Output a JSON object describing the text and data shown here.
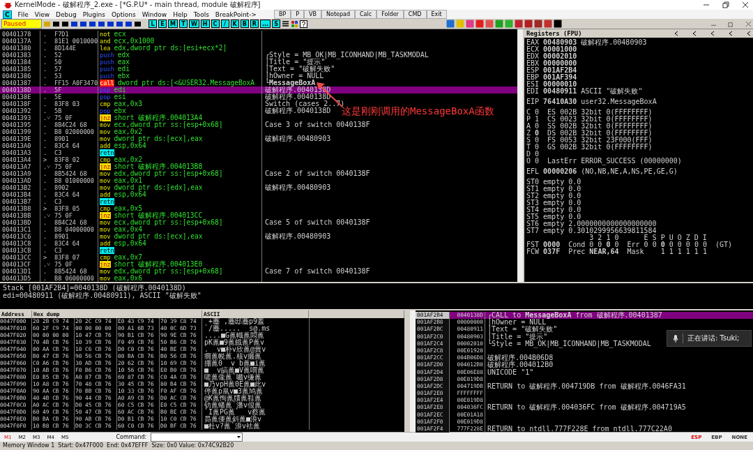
{
  "window": {
    "title": "KernelMode - 破解程序_2.exe - [*G.P.U* - main thread, module 破解程序]"
  },
  "menu": {
    "app_button": "C",
    "items": [
      "File",
      "View",
      "Debug",
      "Plugins",
      "Options",
      "Window",
      "Help",
      "Tools",
      "BreakPoint->"
    ],
    "tool_buttons": [
      "BP",
      "P",
      "VB",
      "Notepad",
      "Calc",
      "Folder",
      "CMD",
      "Exit"
    ]
  },
  "toolbar": {
    "status": "Paused",
    "letter_buttons": [
      "L",
      "E",
      "M",
      "T",
      "W",
      "H",
      "C",
      "/",
      "K",
      "B",
      "R",
      "...",
      "S"
    ]
  },
  "disassembly": [
    {
      "address": "00401378",
      "mark": ".",
      "hex": "F7D1",
      "mnemonic": "not",
      "operands": "ecx",
      "kind": "op",
      "selected": false
    },
    {
      "address": "0040137A",
      "mark": ".",
      "hex": "81E1 0010000",
      "mnemonic": "and",
      "operands": "ecx,0x1000",
      "kind": "op",
      "selected": false
    },
    {
      "address": "00401380",
      "mark": ".",
      "hex": "8D144E",
      "mnemonic": "lea",
      "operands": "edx,dword ptr ds:[esi+ecx*2]",
      "kind": "op",
      "selected": false
    },
    {
      "address": "00401383",
      "mark": ".",
      "hex": "52",
      "mnemonic": "push",
      "operands": "edx",
      "kind": "stack",
      "selected": false,
      "comment": "┌Style = MB_OK|MB_ICONHAND|MB_TASKMODAL"
    },
    {
      "address": "00401384",
      "mark": ".",
      "hex": "50",
      "mnemonic": "push",
      "operands": "eax",
      "kind": "stack",
      "selected": false,
      "comment": "│Title = \"提示\""
    },
    {
      "address": "00401385",
      "mark": ".",
      "hex": "57",
      "mnemonic": "push",
      "operands": "edi",
      "kind": "stack",
      "selected": false,
      "comment": "│Text = \"破解失败\""
    },
    {
      "address": "00401386",
      "mark": ".",
      "hex": "53",
      "mnemonic": "push",
      "operands": "ebx",
      "kind": "stack",
      "selected": false,
      "comment": "│hOwner = NULL"
    },
    {
      "address": "00401387",
      "mark": ".",
      "hex": "FF15 A0F3470",
      "mnemonic": "call",
      "operands": "dword ptr ds:[<&USER32.MessageBoxA",
      "kind": "call",
      "selected": false,
      "comment": "└**MessageBoxA**"
    },
    {
      "address": "0040138D",
      "mark": ".",
      "hex": "5F",
      "mnemonic": "pop",
      "operands": "edi",
      "kind": "stack",
      "selected": true,
      "comment": "破解程序.0040138D"
    },
    {
      "address": "0040138E",
      "mark": ".",
      "hex": "5E",
      "mnemonic": "pop",
      "operands": "esi",
      "kind": "stack",
      "selected": false,
      "comment": "破解程序.0040138D"
    },
    {
      "address": "0040138F",
      "mark": ".",
      "hex": "83F8 03",
      "mnemonic": "cmp",
      "operands": "eax,0x3",
      "kind": "op",
      "selected": false,
      "comment": "Switch (cases 2..7)"
    },
    {
      "address": "00401392",
      "mark": ".",
      "hex": "5B",
      "mnemonic": "pop",
      "operands": "ebx",
      "kind": "stack",
      "selected": false,
      "comment": "破解程序.0040138D"
    },
    {
      "address": "00401393",
      "mark": ".˅",
      "hex": "75 0F",
      "mnemonic": "jnz",
      "operands": "short 破解程序.004013A4",
      "kind": "jump",
      "selected": false
    },
    {
      "address": "00401395",
      "mark": ".",
      "hex": "8B4C24 68",
      "mnemonic": "mov",
      "operands": "ecx,dword ptr ss:[esp+0x68]",
      "kind": "op",
      "selected": false,
      "comment": "Case 3 of switch 0040138F"
    },
    {
      "address": "00401399",
      "mark": ".",
      "hex": "B8 02000000",
      "mnemonic": "mov",
      "operands": "eax,0x2",
      "kind": "op",
      "selected": false
    },
    {
      "address": "0040139E",
      "mark": ".",
      "hex": "8901",
      "mnemonic": "mov",
      "operands": "dword ptr ds:[ecx],eax",
      "kind": "op",
      "selected": false,
      "comment": "破解程序.00480903"
    },
    {
      "address": "004013A0",
      "mark": ".",
      "hex": "83C4 64",
      "mnemonic": "add",
      "operands": "esp,0x64",
      "kind": "op",
      "selected": false
    },
    {
      "address": "004013A3",
      "mark": ".",
      "hex": "C3",
      "mnemonic": "retn",
      "kind": "ret",
      "selected": false
    },
    {
      "address": "004013A4",
      "mark": ">",
      "hex": "83F8 02",
      "mnemonic": "cmp",
      "operands": "eax,0x2",
      "kind": "op",
      "selected": false
    },
    {
      "address": "004013A7",
      "mark": ".˅",
      "hex": "75 0F",
      "mnemonic": "jnz",
      "operands": "short 破解程序.004013B8",
      "kind": "jump",
      "selected": false
    },
    {
      "address": "004013A9",
      "mark": ".",
      "hex": "8B5424 68",
      "mnemonic": "mov",
      "operands": "edx,dword ptr ss:[esp+0x68]",
      "kind": "op",
      "selected": false,
      "comment": "Case 2 of switch 0040138F"
    },
    {
      "address": "004013AD",
      "mark": ".",
      "hex": "B8 01000000",
      "mnemonic": "mov",
      "operands": "eax,0x1",
      "kind": "op",
      "selected": false
    },
    {
      "address": "004013B2",
      "mark": ".",
      "hex": "8902",
      "mnemonic": "mov",
      "operands": "dword ptr ds:[edx],eax",
      "kind": "op",
      "selected": false,
      "comment": "破解程序.00480903"
    },
    {
      "address": "004013B4",
      "mark": ".",
      "hex": "83C4 64",
      "mnemonic": "add",
      "operands": "esp,0x64",
      "kind": "op",
      "selected": false
    },
    {
      "address": "004013B7",
      "mark": ".",
      "hex": "C3",
      "mnemonic": "retn",
      "kind": "ret",
      "selected": false
    },
    {
      "address": "004013B8",
      "mark": ">",
      "hex": "83F8 05",
      "mnemonic": "cmp",
      "operands": "eax,0x5",
      "kind": "op",
      "selected": false
    },
    {
      "address": "004013BB",
      "mark": ".˅",
      "hex": "75 0F",
      "mnemonic": "jnz",
      "operands": "short 破解程序.004013CC",
      "kind": "jump",
      "selected": false
    },
    {
      "address": "004013BD",
      "mark": ".",
      "hex": "8B4C24 68",
      "mnemonic": "mov",
      "operands": "ecx,dword ptr ss:[esp+0x68]",
      "kind": "op",
      "selected": false,
      "comment": "Case 5 of switch 0040138F"
    },
    {
      "address": "004013C1",
      "mark": ".",
      "hex": "B8 04000000",
      "mnemonic": "mov",
      "operands": "eax,0x4",
      "kind": "op",
      "selected": false
    },
    {
      "address": "004013C6",
      "mark": ".",
      "hex": "8901",
      "mnemonic": "mov",
      "operands": "dword ptr ds:[ecx],eax",
      "kind": "op",
      "selected": false,
      "comment": "破解程序.00480903"
    },
    {
      "address": "004013C8",
      "mark": ".",
      "hex": "83C4 64",
      "mnemonic": "add",
      "operands": "esp,0x64",
      "kind": "op",
      "selected": false
    },
    {
      "address": "004013CB",
      "mark": ".",
      "hex": "C3",
      "mnemonic": "retn",
      "kind": "ret",
      "selected": false
    },
    {
      "address": "004013CC",
      "mark": ">",
      "hex": "83F8 07",
      "mnemonic": "cmp",
      "operands": "eax,0x7",
      "kind": "op",
      "selected": false
    },
    {
      "address": "004013CF",
      "mark": ".˅",
      "hex": "75 0F",
      "mnemonic": "jnz",
      "operands": "short 破解程序.004013E0",
      "kind": "jump",
      "selected": false
    },
    {
      "address": "004013D1",
      "mark": ".",
      "hex": "8B5424 68",
      "mnemonic": "mov",
      "operands": "edx,dword ptr ss:[esp+0x68]",
      "kind": "op",
      "selected": false,
      "comment": "Case 7 of switch 0040138F"
    },
    {
      "address": "004013D5",
      "mark": ".",
      "hex": "B8 06000000",
      "mnemonic": "mov",
      "operands": "eax,0x6",
      "kind": "op",
      "selected": false
    }
  ],
  "annotation": {
    "text": "这是刚刚调用的MessageBoxA函数"
  },
  "registers": {
    "title": "Registers (FPU)",
    "groups": [
      [
        "EAX **00480903** 破解程序.00480903",
        "ECX **00001000**",
        "EDX **00002010**",
        "EBX **00000000**",
        "ESP **001AF2B4**",
        "EBP **001AF394**",
        "ESI **00000010**",
        "EDI **00480911** ASCII \"破解失败\""
      ],
      [
        "EIP **76410A30** user32.MessageBoxA"
      ],
      [
        "C 0  ES 002B 32bit 0(FFFFFFFF)",
        "P 1  CS 0023 32bit 0(FFFFFFFF)",
        "A 0  SS 002B 32bit 0(FFFFFFFF)",
        "Z **0**  DS 002B 32bit 0(FFFFFFFF)",
        "S 0  FS 0053 32bit 23F000(FFF)",
        "T 0  GS 002B 32bit 0(FFFFFFFF)",
        "D 0",
        "O 0  LastErr ERROR_SUCCESS (00000000)"
      ],
      [
        "EFL **00000206** (NO,NB,NE,A,NS,PE,GE,G)"
      ],
      [
        "ST0 empty 0.0",
        "ST1 empty 0.0",
        "ST2 empty 0.0",
        "ST3 empty 0.0",
        "ST4 empty 0.0",
        "ST5 empty 0.0",
        "ST6 empty 2.0000000000000000000",
        "ST7 empty 0.3010299956639811584",
        "               3 2 1 0      E S P U O Z D I",
        "FST **0000**  Cond 0 0 **0** 0  Err 0 0 **0** 0 0 0 0 0  (GT)",
        "FCW **037F**  Prec **NEAR,64**  Mask    1 1 1 1 1 1"
      ]
    ]
  },
  "info": [
    "Stack [001AF2B4]=0040138D (破解程序.0040138D)",
    "edi=00480911 (破解程序.00480911), ASCII \"破解失败\""
  ],
  "dump": {
    "columns": [
      "Address",
      "Hex dump",
      "ASCII"
    ],
    "rows": [
      {
        "address": "0047F000",
        "hex": [
          "20 2B C9 74",
          "20 2C C9 74",
          "E0 43 C9 74",
          "70 39 C8 74"
        ],
        "ascii": " +蘪 ,蘪邸蘪p9蓋"
      },
      {
        "address": "0047F010",
        "hex": [
          "60 2F C9 74",
          "00 00 00 00",
          "00 A1 6B 73",
          "40 0C 6D 73"
        ],
        "ascii": "`/蘪.....  s@.ms"
      },
      {
        "address": "0047F020",
        "hex": [
          "00 00 00 00",
          "10 47 CB 76",
          "90 B1 CB 76",
          "90 9E CB 76"
        ],
        "ascii": "....■G蓖幟蓖悶蓖"
      },
      {
        "address": "0047F030",
        "hex": [
          "70 4B CB 76",
          "10 39 CB 76",
          "F0 49 CB 76",
          "50 B6 CB 76"
        ],
        "ascii": "pK蓖■9蓖餓蓖P蓖v"
      },
      {
        "address": "0047F040",
        "hex": [
          "00 AA CB 76",
          "10 C6 CB 76",
          "D0 C0 CB 76",
          "40 BE CB 76"
        ],
        "ascii": ".  v■朴v欣蓖@蕒v"
      },
      {
        "address": "0047F050",
        "hex": [
          "B0 47 CB 76",
          "90 56 CB 76",
          "00 BA CB 76",
          "B0 56 CB 76"
        ],
        "ascii": "癇蓖帨蓖.核v癞蓖"
      },
      {
        "address": "0047F060",
        "hex": [
          "C0 A6 CB 76",
          "30 AD CB 76",
          "20 62 CB 76",
          "10 69 CB 76"
        ],
        "ascii": "掤蓖0  v b蓖■i蓖"
      },
      {
        "address": "0047F070",
        "hex": [
          "10 AB CB 76",
          "F0 B6 CB 76",
          "10 56 CB 76",
          "E0 B0 CB 76"
        ],
        "ascii": "■  v皜蓖■V蓖喟蓖"
      },
      {
        "address": "0047F080",
        "hex": [
          "E0 B5 CB 76",
          "A0 87 CB 76",
          "60 87 CB 76",
          "C0 4A CB 76"
        ],
        "ascii": "嗟蓖儱蓖`嚱v缣蓖"
      },
      {
        "address": "0047F090",
        "hex": [
          "10 A8 CB 76",
          "70 48 CB 76",
          "30 45 CB 76",
          "80 B4 CB 76"
        ],
        "ascii": "■乃vpH蓖0E蓖■此v"
      },
      {
        "address": "0047F0A0",
        "hex": [
          "90 AA CB 76",
          "70 BB CB 76",
          "10 33 CB 76",
          "F0 AF CB 76"
        ],
        "ascii": "停蓖p凰v■3蓖鸠蓖"
      },
      {
        "address": "0047F0B0",
        "hex": [
          "40 4B CB 76",
          "90 44 CB 76",
          "A0 A9 CB 76",
          "D0 AC CB 76"
        ],
        "ascii": "@K蓖恂蓖牘蓖鞋蓖"
      },
      {
        "address": "0047F0C0",
        "hex": [
          "A0 AC CB 76",
          "D0 45 CB 76",
          "60 C5 CB 76",
          "E0 C5 CB 76"
        ],
        "ascii": "钫蓖蟠蓖`潘v佷蓖"
      },
      {
        "address": "0047F0D0",
        "hex": [
          "60 49 CB 76",
          "50 47 CB 76",
          "60 AC CB 76",
          "B0 BE CB 76"
        ],
        "ascii": "`I蓖PG蓖`  v蔡蓖"
      },
      {
        "address": "0047F0E0",
        "hex": [
          "B0 BA CB 76",
          "90 AB CB 76",
          "D0 B1 CB 76",
          "10 C0 CB 76"
        ],
        "ascii": "昴蓖傈蓖斜蓖■浪v"
      },
      {
        "address": "0047F0F0",
        "hex": [
          "10 B8 CB 76",
          "D0 3C CB 76",
          "60 C0 CB 76",
          "D0 BF CB 76"
        ],
        "ascii": "■杜v?蓖`浪v袪蓖"
      }
    ]
  },
  "stack": [
    {
      "address": "001AF2B4",
      "value": "0040138D",
      "comment": "┌CALL to **MessageBoxA** from 破解程序.00401387",
      "selected": true
    },
    {
      "address": "001AF2B8",
      "value": "00000000",
      "comment": "│hOwner = NULL",
      "selected": false
    },
    {
      "address": "001AF2BC",
      "value": "00480911",
      "comment": "│Text = \"破解失败\"",
      "selected": false
    },
    {
      "address": "001AF2C0",
      "value": "00480903",
      "comment": "│Title = \"提示\"",
      "selected": false
    },
    {
      "address": "001AF2C4",
      "value": "00002010",
      "comment": "└Style = MB_OK|MB_ICONHAND|MB_TASKMODAL",
      "selected": false
    },
    {
      "address": "001AF2C8",
      "value": "00E01920",
      "selected": false
    },
    {
      "address": "001AF2CC",
      "value": "004B06D8",
      "comment": "破解程序.004B06D8",
      "selected": false
    },
    {
      "address": "001AF2D0",
      "value": "004012B0",
      "comment": "破解程序.004012B0",
      "selected": false
    },
    {
      "address": "001AF2D4",
      "value": "00E06E88",
      "comment": "UNICODE \"1\"",
      "selected": false
    },
    {
      "address": "001AF2D8",
      "value": "00E019D8",
      "selected": false
    },
    {
      "address": "001AF2DC",
      "value": "004719DB",
      "comment": "RETURN to 破解程序.004719DB from 破解程序.0046FA31",
      "selected": false
    },
    {
      "address": "001AF2E0",
      "value": "FFFFFFFF",
      "selected": false
    },
    {
      "address": "001AF2E4",
      "value": "00E019D8",
      "selected": false
    },
    {
      "address": "001AF2E8",
      "value": "004036FC",
      "comment": "RETURN to 破解程序.004036FC from 破解程序.004719A5",
      "selected": false
    },
    {
      "address": "001AF2EC",
      "value": "00E01A18",
      "selected": false
    },
    {
      "address": "001AF2F0",
      "value": "00E019D8",
      "selected": false
    },
    {
      "address": "001AF2F4",
      "value": "777F228E",
      "comment": "RETURN to ntdll.777F228E from ntdll.777C22A0",
      "selected": false
    }
  ],
  "toast": {
    "text": "正在讲话: Tsuki;"
  },
  "bottom": {
    "memory_tabs": [
      {
        "label": "M1",
        "selected": true
      },
      {
        "label": "M2",
        "selected": false
      },
      {
        "label": "M3",
        "selected": false
      },
      {
        "label": "M4",
        "selected": false
      },
      {
        "label": "M5",
        "selected": false
      }
    ],
    "command_label": "Command:",
    "stack_modes": [
      {
        "label": "ESP",
        "selected": true
      },
      {
        "label": "EBP",
        "selected": false
      },
      {
        "label": "NONE",
        "selected": false
      }
    ]
  },
  "status_bar": "Memory Window 1  Start: 0x47F000  End: 0x47EFFF  Size: 0x0 Value: 0x74C92B20"
}
